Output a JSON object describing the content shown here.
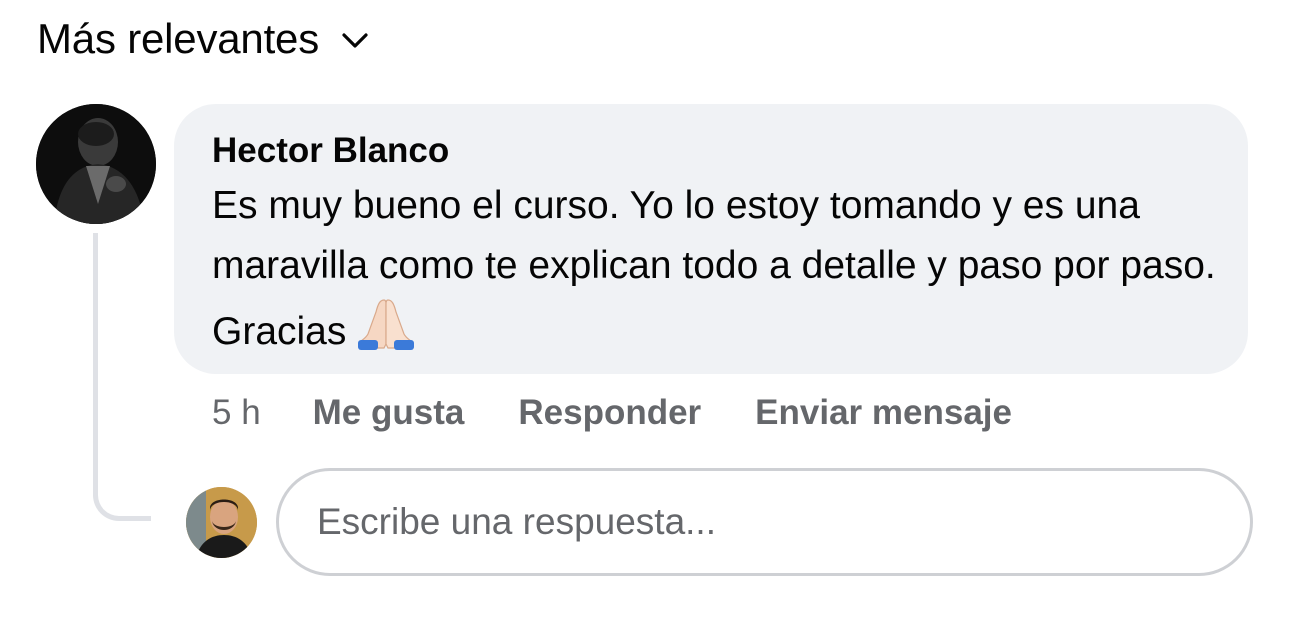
{
  "sort": {
    "label": "Más relevantes",
    "icon": "chevron-down-icon"
  },
  "comment": {
    "author": "Hector Blanco",
    "text": "Es muy bueno el curso. Yo lo estoy tomando y es una maravilla como te explican todo a detalle y paso por paso. Gracias",
    "emoji": "folded-hands-icon",
    "time": "5 h",
    "actions": {
      "like": "Me gusta",
      "reply": "Responder",
      "message": "Enviar mensaje"
    }
  },
  "reply": {
    "placeholder": "Escribe una respuesta..."
  },
  "colors": {
    "bubble": "#f0f2f5",
    "secondary_text": "#65676b",
    "border": "#ced0d4",
    "thread_line": "#dfe1e6"
  }
}
